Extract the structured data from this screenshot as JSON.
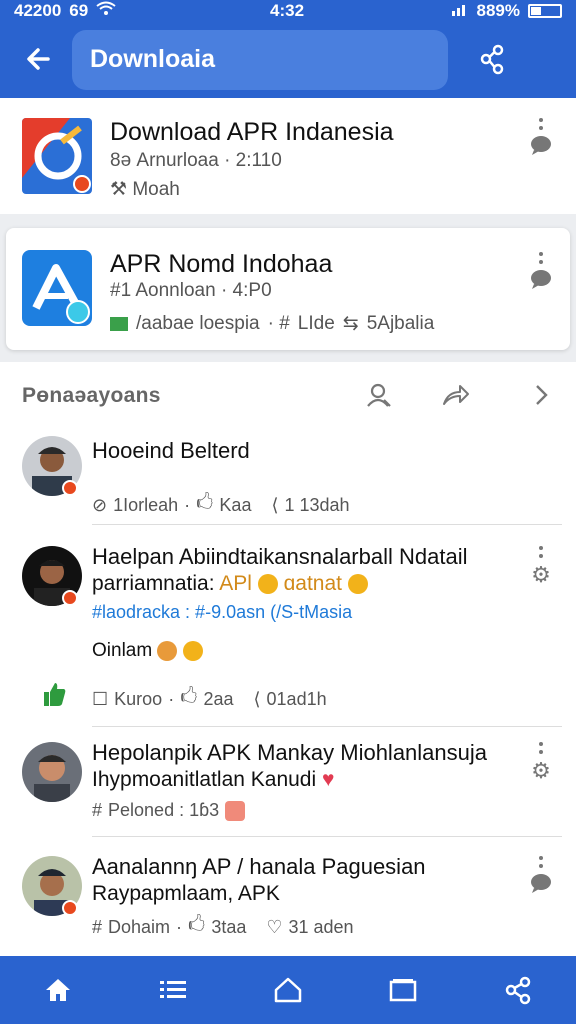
{
  "status_bar": {
    "time_left": "42200",
    "signal_text": "69",
    "clock": "4:32",
    "battery": "889%"
  },
  "app_bar": {
    "search_value": "Downloaia",
    "back_icon": "arrow-left-icon",
    "share_icon": "share-icon"
  },
  "cards": [
    {
      "title": "Download APR Indanesia",
      "meta1": "8ә Arnurloaa · 2:110",
      "meta2": "Moah",
      "icon": "app-logo-red"
    },
    {
      "title": "APR Nomd Indohaa",
      "meta1": "#1 Aonnloan · 4:P0",
      "meta2_a": "/aabae loespia",
      "meta2_b": "LIde",
      "meta2_c": "5Ajbalia",
      "icon": "app-logo-blue"
    }
  ],
  "feed": {
    "section_title": "Pөnaəayoans",
    "posts": [
      {
        "name": "Hooeind Belterd",
        "meta_a": "1Iorleah",
        "meta_b": "Kaa",
        "meta_c": "1 13dah"
      },
      {
        "name": "Haelpan Abiindtaikansnalarball Ndatail",
        "line2_text": "parriamnatia: ",
        "line2_tag": "APl",
        "line2_rest": "ɑatnat",
        "link": "#laodracka : #-9.0asn (/S-tMasia",
        "line4": "Oinlam",
        "meta_a": "Kuroo",
        "meta_b": "2aa",
        "meta_c": "01ad1h"
      },
      {
        "name": "Hepolanpik APK Mankay Miohlanlansuja",
        "line2": "Ihypmoanitlatlan Kanudi",
        "meta_a": "Peloned : 1ɓ3"
      },
      {
        "name": "Aanalannŋ AP / hanala Paguesian",
        "line2": "Raypapmlaam, APK",
        "meta_a": "Dohaim",
        "meta_b": "3taa",
        "meta_c": "31 aden"
      }
    ]
  },
  "bottom_nav": [
    "home-icon",
    "list-icon",
    "house-outline-icon",
    "tabs-icon",
    "share-icon"
  ],
  "colors": {
    "primary": "#2a63cf",
    "link": "#1f7ad8",
    "badge": "#e8491e"
  }
}
